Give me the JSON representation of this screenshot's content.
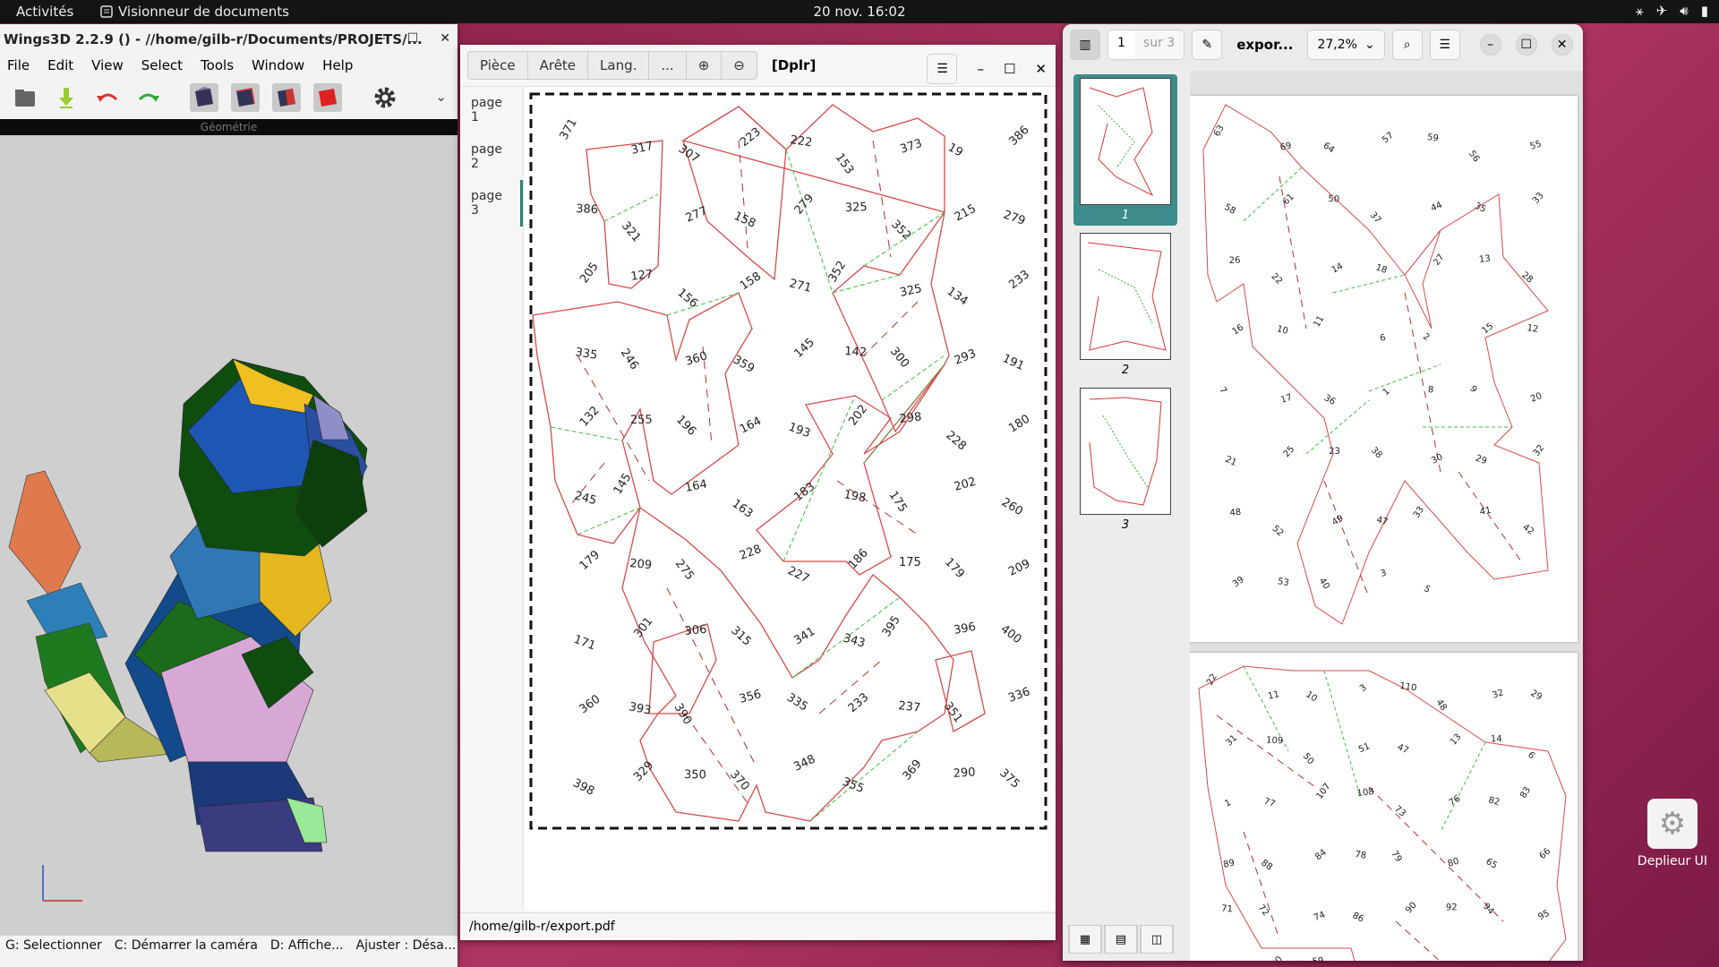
{
  "topbar": {
    "activities": "Activités",
    "app_name": "Visionneur de documents",
    "clock": "20 nov.  16:02"
  },
  "wings": {
    "title": "Wings3D 2.2.9 () - //home/gilb-r/Documents/PROJETS/...",
    "menu": [
      "File",
      "Edit",
      "View",
      "Select",
      "Tools",
      "Window",
      "Help"
    ],
    "geometry_label": "Géométrie",
    "status": [
      "G: Selectionner",
      "C: Démarrer la caméra",
      "D: Affiche...",
      "Ajuster : Désa..."
    ]
  },
  "dplr": {
    "tabs": [
      "Pièce",
      "Arête",
      "Lang.",
      "..."
    ],
    "title": "[Dplr]",
    "pages": [
      "page 1",
      "page 2",
      "page 3"
    ],
    "footer": "/home/gilb-r/export.pdf",
    "labels": [
      "371",
      "317",
      "307",
      "223",
      "222",
      "153",
      "373",
      "19",
      "386",
      "386",
      "321",
      "277",
      "158",
      "279",
      "325",
      "352",
      "215",
      "279",
      "205",
      "127",
      "156",
      "158",
      "271",
      "352",
      "325",
      "134",
      "233",
      "335",
      "246",
      "360",
      "359",
      "145",
      "142",
      "300",
      "293",
      "191",
      "132",
      "255",
      "196",
      "164",
      "193",
      "202",
      "298",
      "228",
      "180",
      "245",
      "145",
      "164",
      "163",
      "183",
      "198",
      "175",
      "202",
      "260",
      "179",
      "209",
      "275",
      "228",
      "227",
      "186",
      "175",
      "179",
      "209",
      "171",
      "301",
      "306",
      "315",
      "341",
      "343",
      "395",
      "396",
      "400",
      "360",
      "393",
      "390",
      "356",
      "335",
      "233",
      "237",
      "351",
      "336",
      "398",
      "329",
      "350",
      "370",
      "348",
      "355",
      "369",
      "290",
      "375"
    ]
  },
  "viewer": {
    "page_current": "1",
    "page_total": "sur 3",
    "doc_title": "expor...",
    "zoom": "27,2%",
    "thumbs": [
      "1",
      "2",
      "3"
    ],
    "labels_p1": [
      "63",
      "69",
      "64",
      "57",
      "59",
      "56",
      "55",
      "58",
      "61",
      "50",
      "37",
      "44",
      "35",
      "33",
      "26",
      "22",
      "14",
      "18",
      "27",
      "13",
      "28",
      "16",
      "10",
      "11",
      "6",
      "2",
      "15",
      "12",
      "7",
      "17",
      "36",
      "1",
      "8",
      "9",
      "20",
      "21",
      "25",
      "23",
      "38",
      "30",
      "29",
      "32",
      "48",
      "52",
      "49",
      "47",
      "33",
      "41",
      "42",
      "39",
      "53",
      "40",
      "3",
      "5"
    ],
    "labels_p2": [
      "22",
      "11",
      "10",
      "3",
      "110",
      "48",
      "32",
      "29",
      "31",
      "109",
      "50",
      "51",
      "47",
      "13",
      "14",
      "6",
      "1",
      "77",
      "107",
      "108",
      "73",
      "76",
      "82",
      "83",
      "89",
      "88",
      "84",
      "78",
      "79",
      "80",
      "65",
      "66",
      "71",
      "72",
      "74",
      "86",
      "90",
      "92",
      "94",
      "95",
      "96",
      "70",
      "59",
      "5"
    ]
  },
  "dock": {
    "label": "Deplieur UI"
  }
}
